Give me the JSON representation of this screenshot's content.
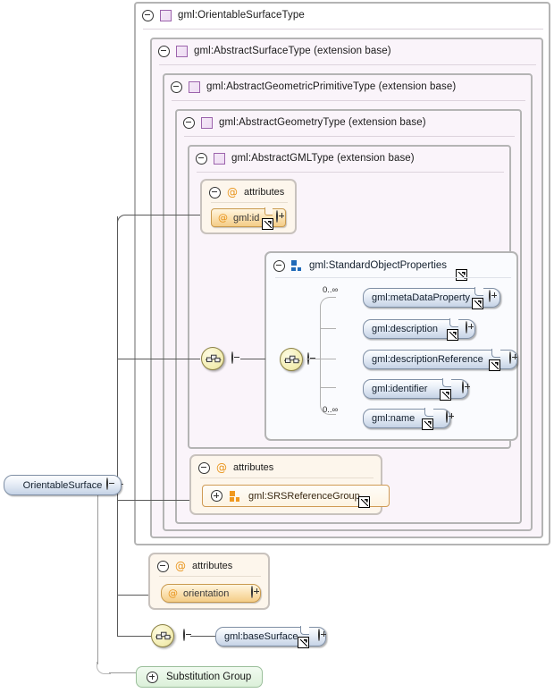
{
  "diagram": {
    "title": "gml:OrientableSurface element XSD diagram",
    "root_element": {
      "label": "OrientableSurface"
    },
    "substitution_group": {
      "label": "Substitution Group",
      "toggle": "plus-circle"
    },
    "type_frames": [
      {
        "label": "gml:OrientableSurfaceType",
        "toggle": "minus-circle",
        "icon": "complextype-icon"
      },
      {
        "label": "gml:AbstractSurfaceType (extension base)",
        "toggle": "minus-circle",
        "icon": "complextype-icon"
      },
      {
        "label": "gml:AbstractGeometricPrimitiveType (extension base)",
        "toggle": "minus-circle",
        "icon": "complextype-icon"
      },
      {
        "label": "gml:AbstractGeometryType (extension base)",
        "toggle": "minus-circle",
        "icon": "complextype-icon"
      },
      {
        "label": "gml:AbstractGMLType (extension base)",
        "toggle": "minus-circle",
        "icon": "complextype-icon"
      }
    ],
    "attribute_boxes": [
      {
        "label": "attributes",
        "toggle": "minus-circle",
        "icon": "at-icon",
        "items": [
          {
            "label": "gml:id",
            "icon": "at-icon",
            "toggle": "plus-circle",
            "linked": true
          }
        ]
      },
      {
        "label": "attributes",
        "toggle": "minus-circle",
        "icon": "at-icon",
        "items": [
          {
            "label": "gml:SRSReferenceGroup",
            "icon": "attributegroup-icon",
            "toggle": "plus-circle",
            "linked": true
          }
        ]
      },
      {
        "label": "attributes",
        "toggle": "minus-circle",
        "icon": "at-icon",
        "items": [
          {
            "label": "orientation",
            "icon": "at-icon",
            "toggle": "plus-circle",
            "linked": false
          }
        ]
      }
    ],
    "group_box": {
      "label": "gml:StandardObjectProperties",
      "toggle": "minus-circle",
      "icon": "modelgroup-icon",
      "linked": true,
      "sequence_toggle": "minus-circle",
      "children": [
        {
          "label": "gml:metaDataProperty",
          "occurrence": "0..∞",
          "toggle": "plus-circle",
          "linked": true
        },
        {
          "label": "gml:description",
          "occurrence": "",
          "toggle": "plus-circle",
          "linked": true
        },
        {
          "label": "gml:descriptionReference",
          "occurrence": "",
          "toggle": "plus-circle",
          "linked": true
        },
        {
          "label": "gml:identifier",
          "occurrence": "",
          "toggle": "plus-circle",
          "linked": true
        },
        {
          "label": "gml:name",
          "occurrence": "0..∞",
          "toggle": "plus-circle",
          "linked": true
        }
      ]
    },
    "base_surface": {
      "label": "gml:baseSurface",
      "toggle": "plus-circle",
      "linked": true,
      "sequence_toggle": "minus-circle"
    },
    "colors": {
      "frame_border": "#b4b4b4",
      "frame_fill": "#faf4fa",
      "attribute_fill": "#fdf6ec",
      "attribute_accent": "#e8941b",
      "element_accent": "#1f69b8",
      "sequence_fill": "#f4eeb4",
      "substitution_fill": "#dcf0d9",
      "connector": "#595959"
    }
  }
}
